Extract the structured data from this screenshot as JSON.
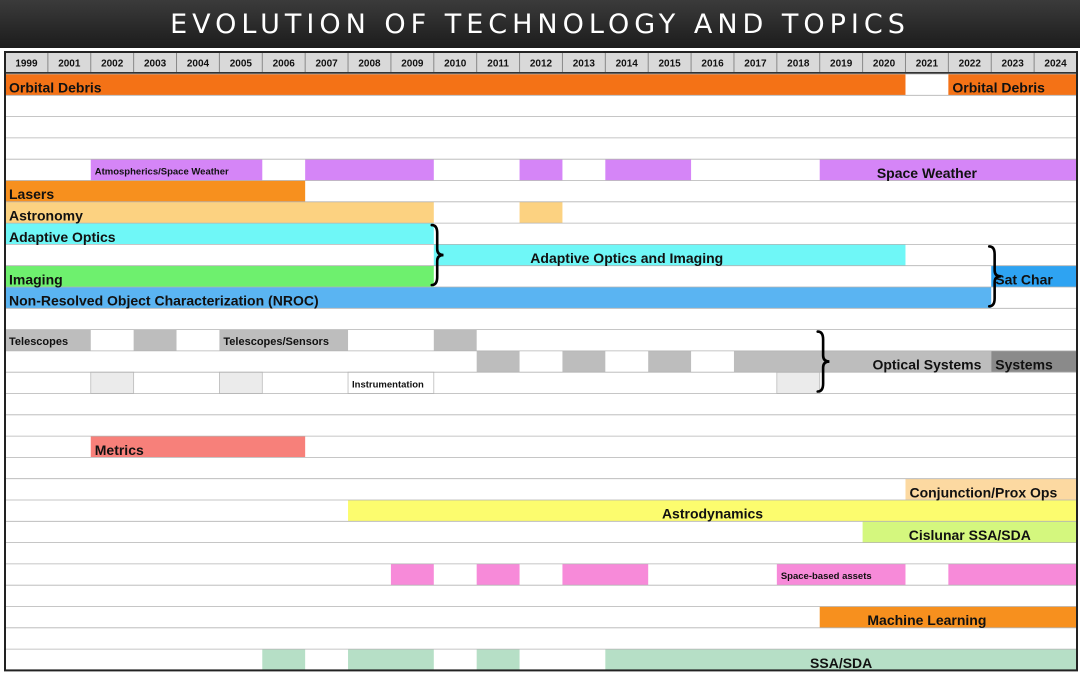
{
  "page": {
    "title": "EVOLUTION OF TECHNOLOGY AND TOPICS"
  },
  "chart_data": {
    "type": "table",
    "title": "EVOLUTION OF TECHNOLOGY AND TOPICS",
    "years": [
      1999,
      2001,
      2002,
      2003,
      2004,
      2005,
      2006,
      2007,
      2008,
      2009,
      2010,
      2011,
      2012,
      2013,
      2014,
      2015,
      2016,
      2017,
      2018,
      2019,
      2020,
      2021,
      2022,
      2023,
      2024
    ],
    "rows": 28,
    "bars": [
      {
        "row": 1,
        "start": 1999,
        "end": 2020,
        "color": "#f47216"
      },
      {
        "row": 1,
        "start": 2022,
        "end": 2024,
        "color": "#f47216"
      },
      {
        "row": 5,
        "start": 2002,
        "end": 2005,
        "color": "#d585f7"
      },
      {
        "row": 5,
        "start": 2007,
        "end": 2009,
        "color": "#d585f7"
      },
      {
        "row": 5,
        "start": 2012,
        "end": 2012,
        "color": "#d585f7"
      },
      {
        "row": 5,
        "start": 2014,
        "end": 2015,
        "color": "#d585f7"
      },
      {
        "row": 5,
        "start": 2019,
        "end": 2024,
        "color": "#d585f7"
      },
      {
        "row": 6,
        "start": 1999,
        "end": 2006,
        "color": "#f7901e"
      },
      {
        "row": 7,
        "start": 1999,
        "end": 2009,
        "color": "#fcd281"
      },
      {
        "row": 7,
        "start": 2012,
        "end": 2012,
        "color": "#fcd281"
      },
      {
        "row": 8,
        "start": 1999,
        "end": 2009,
        "color": "#6ff7f7"
      },
      {
        "row": 9,
        "start": 2010,
        "end": 2020,
        "color": "#6ff7f7"
      },
      {
        "row": 10,
        "start": 1999,
        "end": 2009,
        "color": "#6ef06e"
      },
      {
        "row": 10,
        "start": 2023,
        "end": 2024,
        "color": "#2ea3f2"
      },
      {
        "row": 11,
        "start": 1999,
        "end": 2022,
        "color": "#5ab4f2"
      },
      {
        "row": 13,
        "start": 1999,
        "end": 2001,
        "color": "#bdbdbd"
      },
      {
        "row": 13,
        "start": 2003,
        "end": 2003,
        "color": "#bdbdbd"
      },
      {
        "row": 13,
        "start": 2005,
        "end": 2007,
        "color": "#bdbdbd"
      },
      {
        "row": 13,
        "start": 2010,
        "end": 2010,
        "color": "#bdbdbd"
      },
      {
        "row": 14,
        "start": 2011,
        "end": 2011,
        "color": "#bdbdbd"
      },
      {
        "row": 14,
        "start": 2013,
        "end": 2013,
        "color": "#bdbdbd"
      },
      {
        "row": 14,
        "start": 2015,
        "end": 2015,
        "color": "#bdbdbd"
      },
      {
        "row": 14,
        "start": 2017,
        "end": 2022,
        "color": "#bdbdbd"
      },
      {
        "row": 14,
        "start": 2023,
        "end": 2024,
        "color": "#8a8a8a"
      },
      {
        "row": 15,
        "start": 2002,
        "end": 2002,
        "color": "#ebebeb"
      },
      {
        "row": 15,
        "start": 2005,
        "end": 2005,
        "color": "#ebebeb"
      },
      {
        "row": 15,
        "start": 2008,
        "end": 2009,
        "color": "#ffffff"
      },
      {
        "row": 15,
        "start": 2018,
        "end": 2018,
        "color": "#ebebeb"
      },
      {
        "row": 18,
        "start": 2002,
        "end": 2006,
        "color": "#f7807a"
      },
      {
        "row": 20,
        "start": 2021,
        "end": 2024,
        "color": "#fcd9a1"
      },
      {
        "row": 21,
        "start": 2008,
        "end": 2024,
        "color": "#fcfc6e"
      },
      {
        "row": 22,
        "start": 2020,
        "end": 2024,
        "color": "#d4f77e"
      },
      {
        "row": 24,
        "start": 2009,
        "end": 2009,
        "color": "#f78ad9"
      },
      {
        "row": 24,
        "start": 2011,
        "end": 2011,
        "color": "#f78ad9"
      },
      {
        "row": 24,
        "start": 2013,
        "end": 2014,
        "color": "#f78ad9"
      },
      {
        "row": 24,
        "start": 2018,
        "end": 2020,
        "color": "#f78ad9"
      },
      {
        "row": 24,
        "start": 2022,
        "end": 2024,
        "color": "#f78ad9"
      },
      {
        "row": 26,
        "start": 2019,
        "end": 2024,
        "color": "#f7901e"
      },
      {
        "row": 28,
        "start": 2006,
        "end": 2006,
        "color": "#b6dfc6"
      },
      {
        "row": 28,
        "start": 2008,
        "end": 2009,
        "color": "#b6dfc6"
      },
      {
        "row": 28,
        "start": 2011,
        "end": 2011,
        "color": "#b6dfc6"
      },
      {
        "row": 28,
        "start": 2014,
        "end": 2024,
        "color": "#b6dfc6"
      }
    ],
    "labels": [
      {
        "row": 1,
        "text": "Orbital Debris",
        "year": 1999,
        "align": "start",
        "size": "large"
      },
      {
        "row": 1,
        "text": "Orbital Debris",
        "year": 2022,
        "align": "start",
        "size": "large"
      },
      {
        "row": 5,
        "text": "Atmospherics/Space Weather",
        "year": 2002,
        "align": "start",
        "size": "small"
      },
      {
        "row": 5,
        "text": "Space Weather",
        "year": 2021,
        "align": "center",
        "size": "large"
      },
      {
        "row": 6,
        "text": "Lasers",
        "year": 1999,
        "align": "start",
        "size": "large"
      },
      {
        "row": 7,
        "text": "Astronomy",
        "year": 1999,
        "align": "start",
        "size": "large"
      },
      {
        "row": 8,
        "text": "Adaptive Optics",
        "year": 1999,
        "align": "start",
        "size": "large"
      },
      {
        "row": 9,
        "text": "Adaptive Optics and Imaging",
        "year": 2014,
        "align": "center",
        "size": "large"
      },
      {
        "row": 10,
        "text": "Imaging",
        "year": 1999,
        "align": "start",
        "size": "large"
      },
      {
        "row": 10,
        "text": "Sat Char",
        "year": 2023,
        "align": "start",
        "size": "large"
      },
      {
        "row": 11,
        "text": "Non-Resolved Object Characterization (NROC)",
        "year": 1999,
        "align": "start",
        "size": "large"
      },
      {
        "row": 13,
        "text": "Telescopes",
        "year": 1999,
        "align": "start",
        "size": "medium"
      },
      {
        "row": 13,
        "text": "Telescopes/Sensors",
        "year": 2005,
        "align": "start",
        "size": "medium"
      },
      {
        "row": 14,
        "text": "Optical Systems",
        "year": 2021,
        "align": "center",
        "size": "large"
      },
      {
        "row": 14,
        "text": "Systems",
        "year": 2023,
        "align": "start",
        "size": "large"
      },
      {
        "row": 15,
        "text": "Instrumentation",
        "year": 2008,
        "align": "start",
        "size": "small"
      },
      {
        "row": 18,
        "text": "Metrics",
        "year": 2002,
        "align": "start",
        "size": "large"
      },
      {
        "row": 20,
        "text": "Conjunction/Prox Ops",
        "year": 2021,
        "align": "start",
        "size": "large"
      },
      {
        "row": 21,
        "text": "Astrodynamics",
        "year": 2016,
        "align": "center",
        "size": "large"
      },
      {
        "row": 22,
        "text": "Cislunar SSA/SDA",
        "year": 2022,
        "align": "center",
        "size": "large"
      },
      {
        "row": 24,
        "text": "Space-based assets",
        "year": 2018,
        "align": "start",
        "size": "small"
      },
      {
        "row": 26,
        "text": "Machine Learning",
        "year": 2021,
        "align": "center",
        "size": "large"
      },
      {
        "row": 28,
        "text": "SSA/SDA",
        "year": 2019,
        "align": "center",
        "size": "large"
      }
    ],
    "braces": [
      {
        "row_start": 8,
        "row_end": 10,
        "after_year": 2009
      },
      {
        "row_start": 9,
        "row_end": 11,
        "after_year": 2022
      },
      {
        "row_start": 13,
        "row_end": 15,
        "after_year": 2018
      }
    ]
  }
}
